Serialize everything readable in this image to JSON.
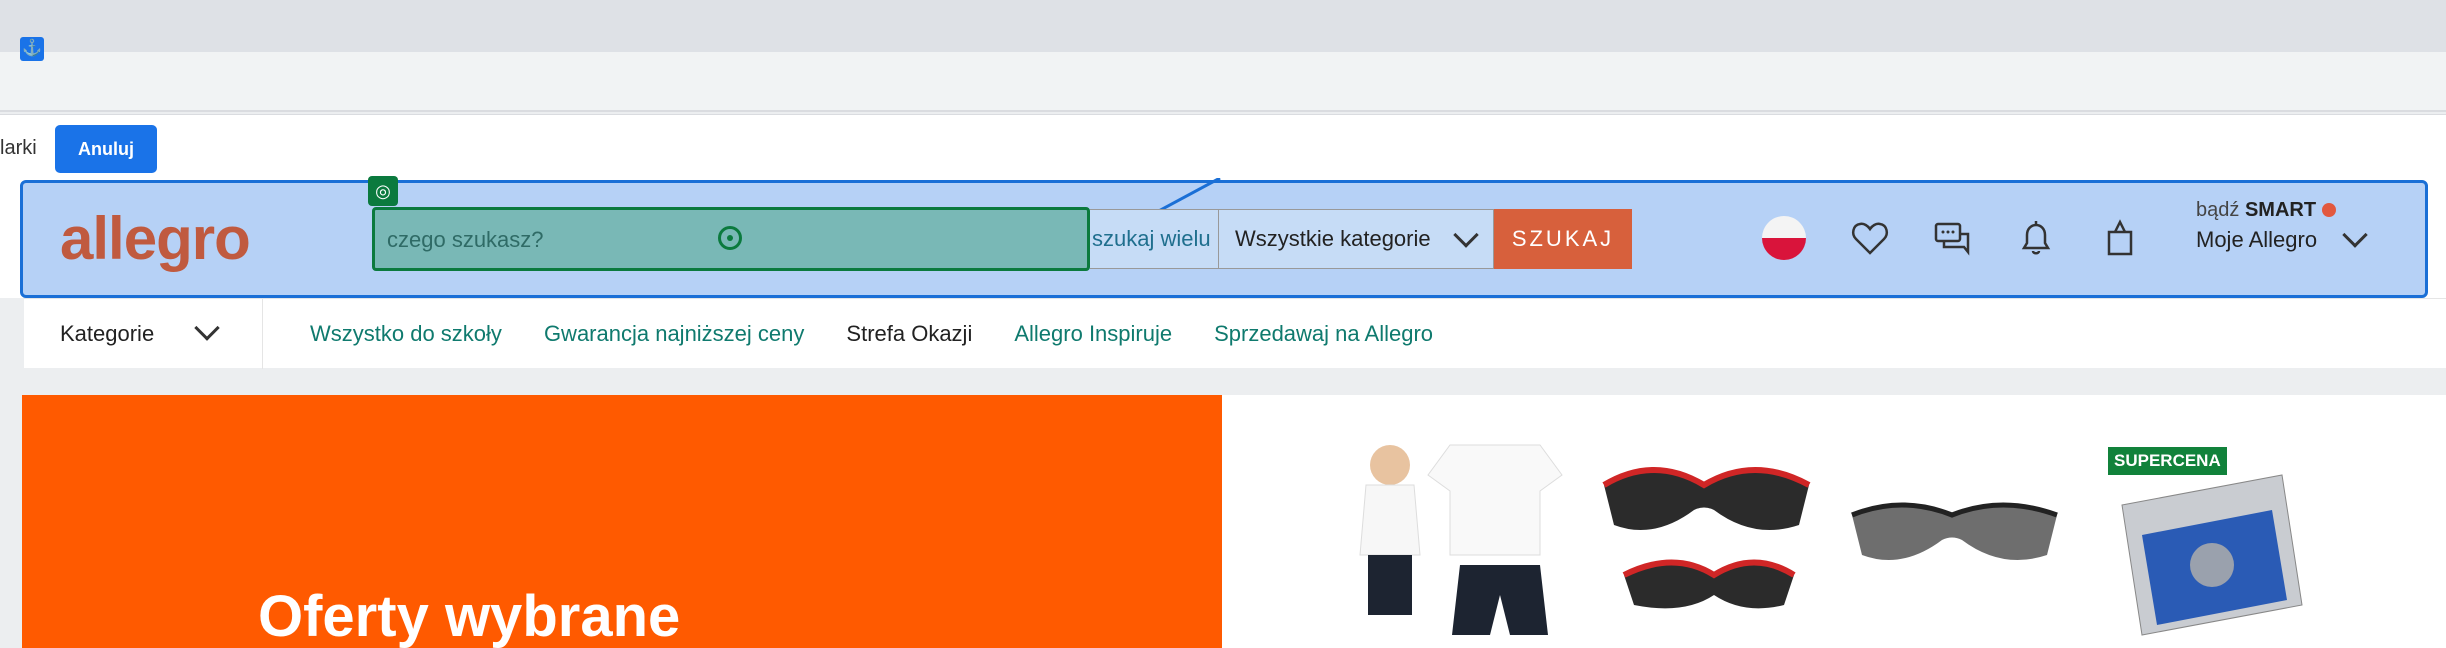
{
  "toolbar": {
    "partial_text": "larki",
    "cancel_label": "Anuluj"
  },
  "header": {
    "logo": "allegro",
    "search": {
      "placeholder": "czego szukasz?",
      "search_many": "szukaj wielu",
      "category": "Wszystkie kategorie",
      "button": "SZUKAJ"
    },
    "smart_prefix": "bądź",
    "smart_label": "SMART",
    "account_label": "Moje Allegro"
  },
  "nav": {
    "categories_label": "Kategorie",
    "links": [
      "Wszystko do szkoły",
      "Gwarancja najniższej ceny",
      "Strefa Okazji",
      "Allegro Inspiruje",
      "Sprzedawaj na Allegro"
    ]
  },
  "banner": {
    "headline": "Oferty wybrane"
  },
  "products": {
    "badge": "SUPERCENA"
  },
  "colors": {
    "brand": "#ff5a00",
    "search_button": "#d7603c",
    "overlay": "#1a6fd6",
    "target": "#0b7a3e"
  }
}
